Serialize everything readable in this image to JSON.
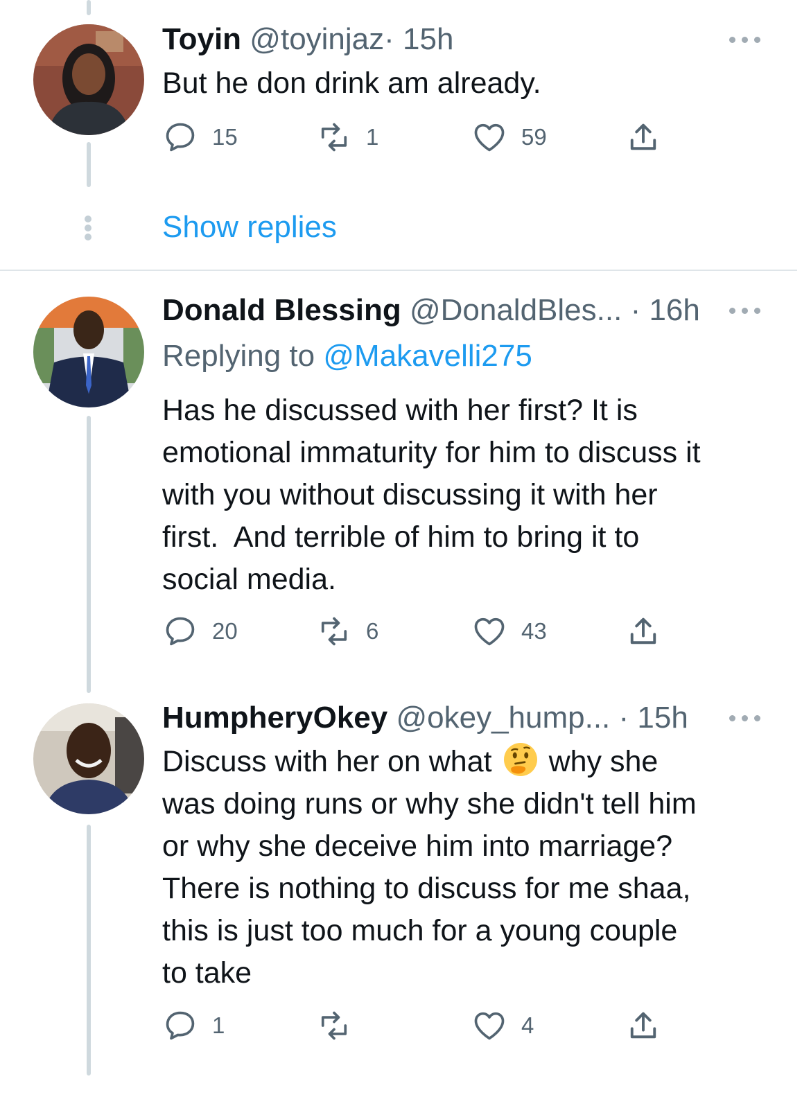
{
  "tweets": [
    {
      "name": "Toyin",
      "handle": "@toyinjaz",
      "time": "· 15h",
      "text": "But he don drink am already.",
      "replies": "15",
      "retweets": "1",
      "likes": "59"
    },
    {
      "name": "Donald Blessing",
      "handle": "@DonaldBles...",
      "time": "· 16h",
      "replying_prefix": "Replying to",
      "replying_handle": "@Makavelli275",
      "text_lines": [
        "Has he discussed with her first? It is",
        "emotional immaturity for him to discuss it",
        "with you without discussing it with her",
        "first.  And terrible of him to bring it to",
        "social media."
      ],
      "replies": "20",
      "retweets": "6",
      "likes": "43"
    },
    {
      "name": "HumpheryOkey",
      "handle": "@okey_hump...",
      "time": "· 15h",
      "text_line1_before": "Discuss with her on what",
      "text_line1_after": "why she",
      "text_lines": [
        "was doing runs or why she didn't tell him",
        "or why she deceive him into marriage?",
        "There is nothing to discuss for me shaa,",
        "this is just too much for a young couple",
        "to take"
      ],
      "emoji_icon": "thinking-face-emoji",
      "replies": "1",
      "retweets": "",
      "likes": "4"
    }
  ],
  "show_replies": "Show replies",
  "icons": {
    "reply": "reply-icon",
    "retweet": "retweet-icon",
    "like": "heart-icon",
    "share": "share-icon",
    "more": "more-icon"
  },
  "colors": {
    "link": "#1d9bf0",
    "muted": "#536471",
    "thread_line": "#cfd9de",
    "text": "#0f1419"
  }
}
